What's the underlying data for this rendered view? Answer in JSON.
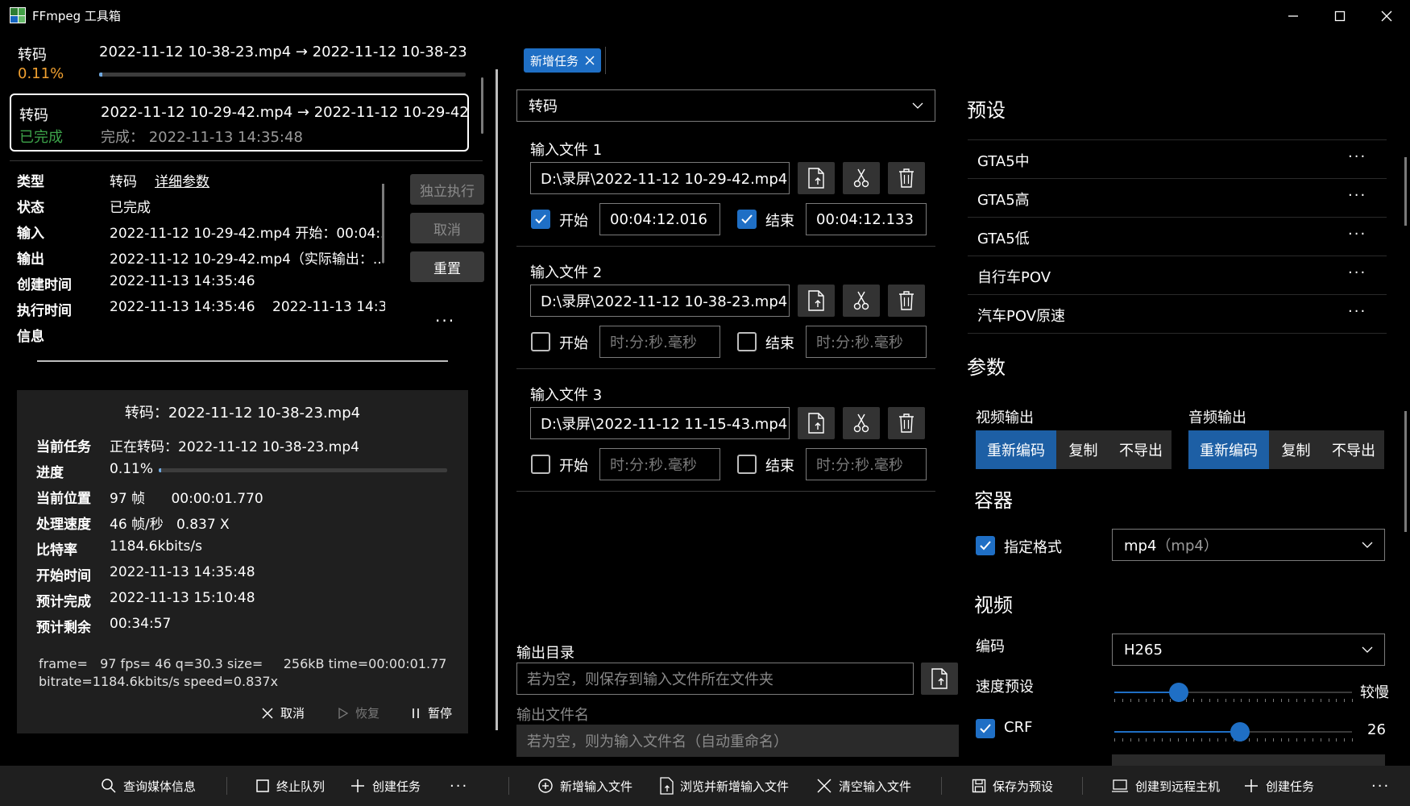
{
  "window": {
    "title": "FFmpeg 工具箱"
  },
  "queue": [
    {
      "kind": "转码",
      "status": "0.11%",
      "name": "2022-11-12 10-38-23.mp4 → 2022-11-12 10-38-23...",
      "progress": 0.0011
    },
    {
      "kind": "转码",
      "status": "已完成",
      "name": "2022-11-12 10-29-42.mp4 → 2022-11-12 10-29-42...",
      "detail": "完成：  2022-11-13 14:35:48"
    }
  ],
  "details": {
    "type_label": "类型",
    "type_value": "转码",
    "detail_link": "详细参数",
    "status_label": "状态",
    "status_value": "已完成",
    "input_label": "输入",
    "input_value": "2022-11-12 10-29-42.mp4 开始：00:04:...",
    "output_label": "输出",
    "output_value": "2022-11-12 10-29-42.mp4（实际输出：...",
    "created_label": "创建时间",
    "created_value": "2022-11-13 14:35:46",
    "exec_label": "执行时间",
    "exec_value": "2022-11-13 14:35:46",
    "exec_value2": "2022-11-13 14:3",
    "info_label": "信息"
  },
  "detail_buttons": {
    "run": "独立执行",
    "cancel": "取消",
    "reset": "重置",
    "more": "···"
  },
  "progress_panel": {
    "title": "转码：2022-11-12 10-38-23.mp4",
    "rows": [
      {
        "label": "当前任务",
        "value": "正在转码：2022-11-12 10-38-23.mp4"
      },
      {
        "label": "进度",
        "value": "0.11%"
      },
      {
        "label": "当前位置",
        "value": "97 帧      00:00:01.770"
      },
      {
        "label": "处理速度",
        "value": "46 帧/秒   0.837 X"
      },
      {
        "label": "比特率",
        "value": "1184.6kbits/s"
      },
      {
        "label": "开始时间",
        "value": "2022-11-13 14:35:48"
      },
      {
        "label": "预计完成",
        "value": "2022-11-13 15:10:48"
      },
      {
        "label": "预计剩余",
        "value": "00:34:57"
      }
    ],
    "progress": 0.0011,
    "log1": "frame=   97 fps= 46 q=30.3 size=     256kB time=00:00:01.77",
    "log2": "bitrate=1184.6kbits/s speed=0.837x",
    "cancel": "取消",
    "resume": "恢复",
    "pause": "暂停"
  },
  "tab": {
    "label": "新增任务"
  },
  "task_type": "转码",
  "inputs": [
    {
      "label": "输入文件 1",
      "path": "D:\\录屏\\2022-11-12 10-29-42.mp4",
      "start_checked": true,
      "start": "00:04:12.016",
      "end_checked": true,
      "end": "00:04:12.133"
    },
    {
      "label": "输入文件 2",
      "path": "D:\\录屏\\2022-11-12 10-38-23.mp4",
      "start_checked": false,
      "start": "",
      "end_checked": false,
      "end": ""
    },
    {
      "label": "输入文件 3",
      "path": "D:\\录屏\\2022-11-12 11-15-43.mp4",
      "start_checked": false,
      "start": "",
      "end_checked": false,
      "end": ""
    }
  ],
  "labels": {
    "start": "开始",
    "end": "结束",
    "time_placeholder": "时:分:秒.毫秒"
  },
  "output": {
    "dir_label": "输出目录",
    "dir_placeholder": "若为空，则保存到输入文件所在文件夹",
    "name_label": "输出文件名",
    "name_placeholder": "若为空，则为输入文件名（自动重命名）"
  },
  "presets": {
    "title": "预设",
    "items": [
      "GTA5中",
      "GTA5高",
      "GTA5低",
      "自行车POV",
      "汽车POV原速"
    ],
    "more": "···"
  },
  "params": {
    "title": "参数",
    "video_out": "视频输出",
    "audio_out": "音频输出",
    "seg": [
      "重新编码",
      "复制",
      "不导出"
    ],
    "container_title": "容器",
    "specify_format": "指定格式",
    "format_value": "mp4",
    "format_hint": "（mp4）",
    "video_title": "视频",
    "codec_label": "编码",
    "codec_value": "H265",
    "speed_label": "速度预设",
    "speed_value_text": "较慢",
    "speed_level": 0.27,
    "crf_label": "CRF",
    "crf_value": "26",
    "crf_level": 0.53
  },
  "bottom": {
    "query": "查询媒体信息",
    "stop_queue": "终止队列",
    "create": "创建任务",
    "more": "···",
    "add_input": "新增输入文件",
    "browse_add": "浏览并新增输入文件",
    "clear_inputs": "清空输入文件",
    "save_preset": "保存为预设",
    "remote": "创建到远程主机",
    "create2": "创建任务",
    "more2": "···"
  },
  "colors": {
    "accent": "#1f6fc5",
    "progress_orange": "#f0a030",
    "done_green": "#3da34a"
  }
}
